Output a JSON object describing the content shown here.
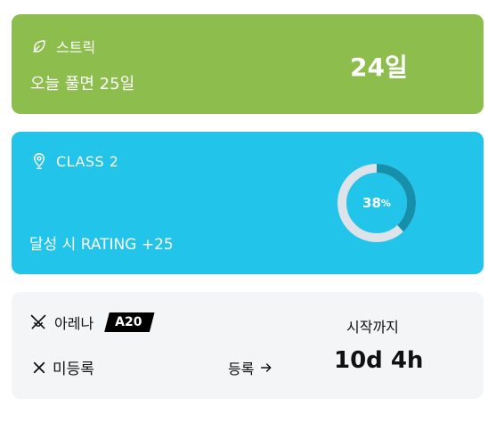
{
  "streak": {
    "title": "스트릭",
    "subtitle": "오늘 풀면 25일",
    "value": "24일",
    "background": "#8cbd4d",
    "icon": "leaf-icon"
  },
  "class_card": {
    "title": "CLASS 2",
    "subtitle": "달성 시 RATING +25",
    "progress_percent": 38,
    "progress_number": "38",
    "progress_unit": "%",
    "background": "#22c4ea",
    "ring_track_color": "#dde3e8",
    "ring_fill_color": "#168fab",
    "icon": "map-pin-icon"
  },
  "arena": {
    "title": "아레나",
    "badge": "A20",
    "status": "미등록",
    "register_label": "등록",
    "until_label": "시작까지",
    "countdown": "10d 4h",
    "background": "#f4f5f7",
    "icon": "crossed-swords-icon",
    "status_icon": "close-icon",
    "register_icon": "arrow-right-icon"
  }
}
